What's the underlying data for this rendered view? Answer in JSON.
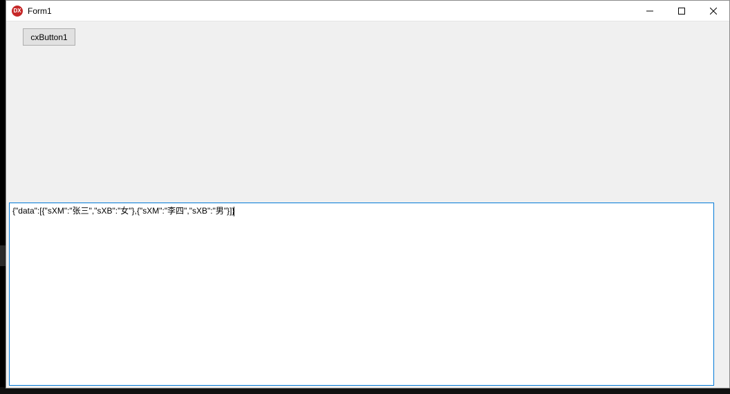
{
  "window": {
    "title": "Form1",
    "icon_text": "DX"
  },
  "toolbar": {
    "button1_label": "cxButton1"
  },
  "memo": {
    "content": "{\"data\":[{\"sXM\":\"张三\",\"sXB\":\"女\"},{\"sXM\":\"李四\",\"sXB\":\"男\"}]}"
  }
}
